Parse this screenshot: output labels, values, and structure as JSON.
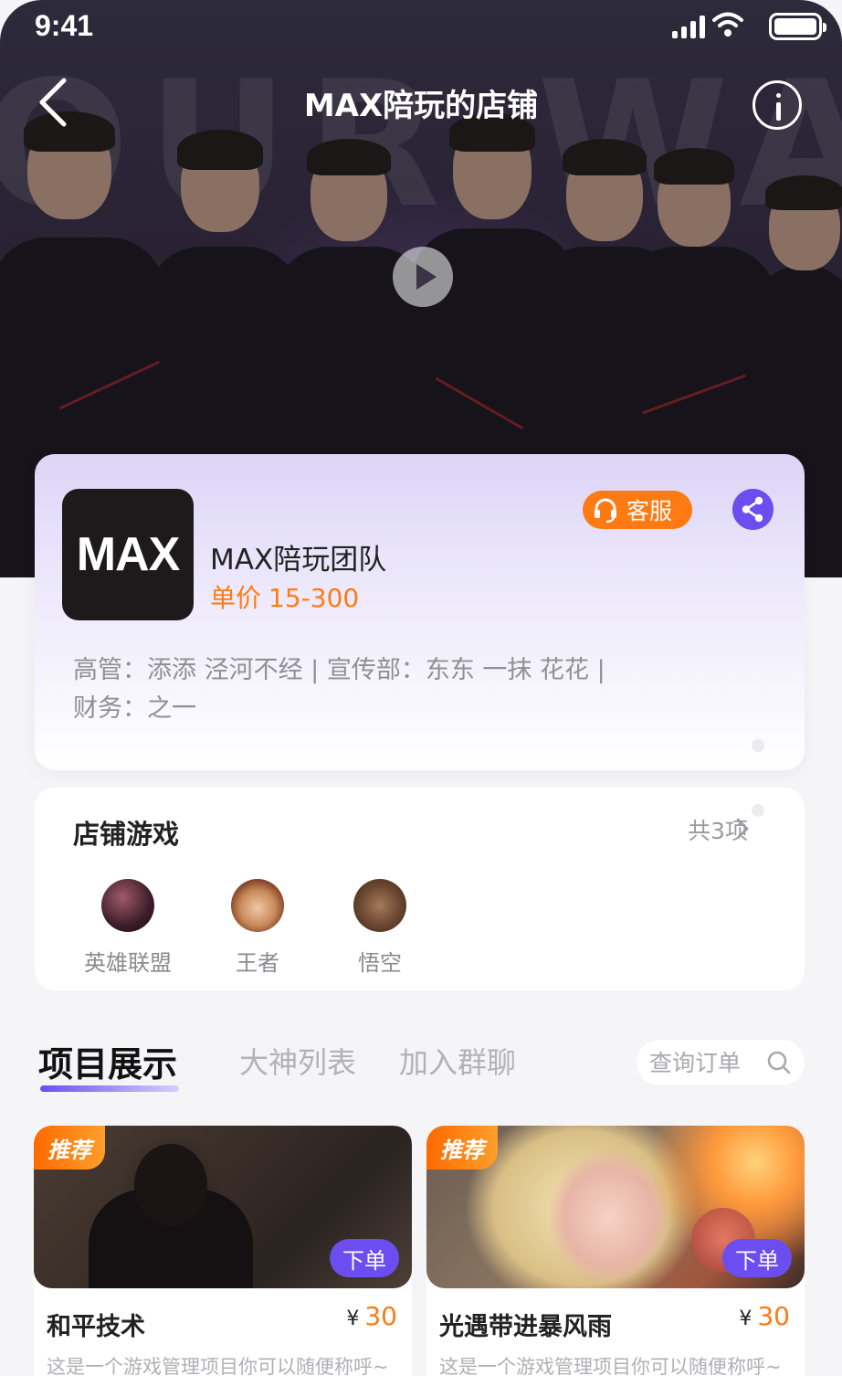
{
  "status_bar": {
    "time": "9:41"
  },
  "nav": {
    "title": "MAX陪玩的店铺"
  },
  "shop": {
    "logo_text": "MAX",
    "name": "MAX陪玩团队",
    "price_label": "单价",
    "price_range": "15-300",
    "customer_service_label": "客服",
    "staff_line_1": "高管：添添  泾河不经 | 宣传部：东东  一抹  花花 |",
    "staff_line_2": "财务：之一"
  },
  "games": {
    "title": "店铺游戏",
    "count_label": "共3项",
    "items": [
      {
        "label": "英雄联盟"
      },
      {
        "label": "王者"
      },
      {
        "label": "悟空"
      }
    ]
  },
  "tabs": [
    {
      "label": "项目展示",
      "active": true
    },
    {
      "label": "大神列表",
      "active": false
    },
    {
      "label": "加入群聊",
      "active": false
    }
  ],
  "search": {
    "placeholder": "查询订单"
  },
  "products": [
    {
      "badge": "推荐",
      "order_label": "下单",
      "title": "和平技术",
      "currency": "¥",
      "price": "30",
      "desc": "这是一个游戏管理项目你可以随便称呼~"
    },
    {
      "badge": "推荐",
      "order_label": "下单",
      "title": "光遇带进暴风雨",
      "currency": "¥",
      "price": "30",
      "desc": "这是一个游戏管理项目你可以随便称呼~"
    }
  ],
  "colors": {
    "accent": "#6c4ef0",
    "orange": "#ff7a12"
  }
}
